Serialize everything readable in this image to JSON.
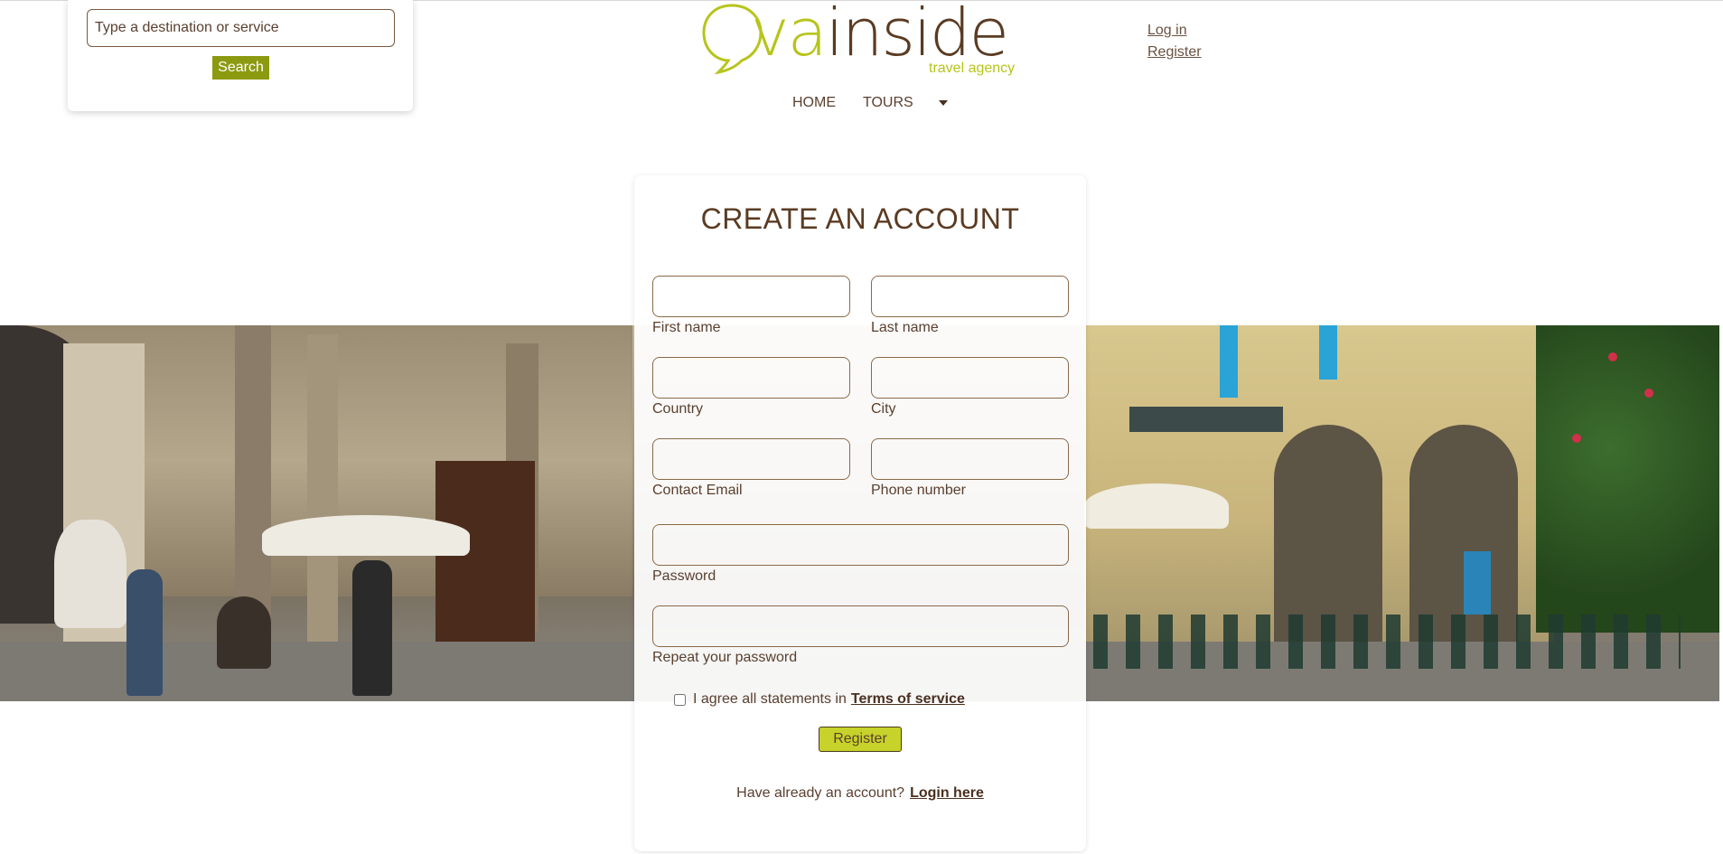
{
  "search": {
    "placeholder": "Type a destination or service",
    "button_label": "Search"
  },
  "logo": {
    "word_part1": "va",
    "word_part2": "inside",
    "tagline": "travel agency"
  },
  "auth": {
    "login_label": "Log in",
    "register_label": "Register"
  },
  "nav": {
    "home": "HOME",
    "tours": "TOURS"
  },
  "form": {
    "title": "CREATE AN ACCOUNT",
    "first_name": "First name",
    "last_name": "Last name",
    "country": "Country",
    "city": "City",
    "email": "Contact Email",
    "phone": "Phone number",
    "password": "Password",
    "repeat_password": "Repeat your password",
    "agree_text": "I agree all statements in",
    "terms_link": "Terms of service",
    "register_button": "Register",
    "already_text": "Have already an account?",
    "login_link": "Login here"
  },
  "colors": {
    "accent_green": "#b7c41a",
    "button_green": "#8c9a10",
    "brand_brown": "#5a3b22"
  }
}
